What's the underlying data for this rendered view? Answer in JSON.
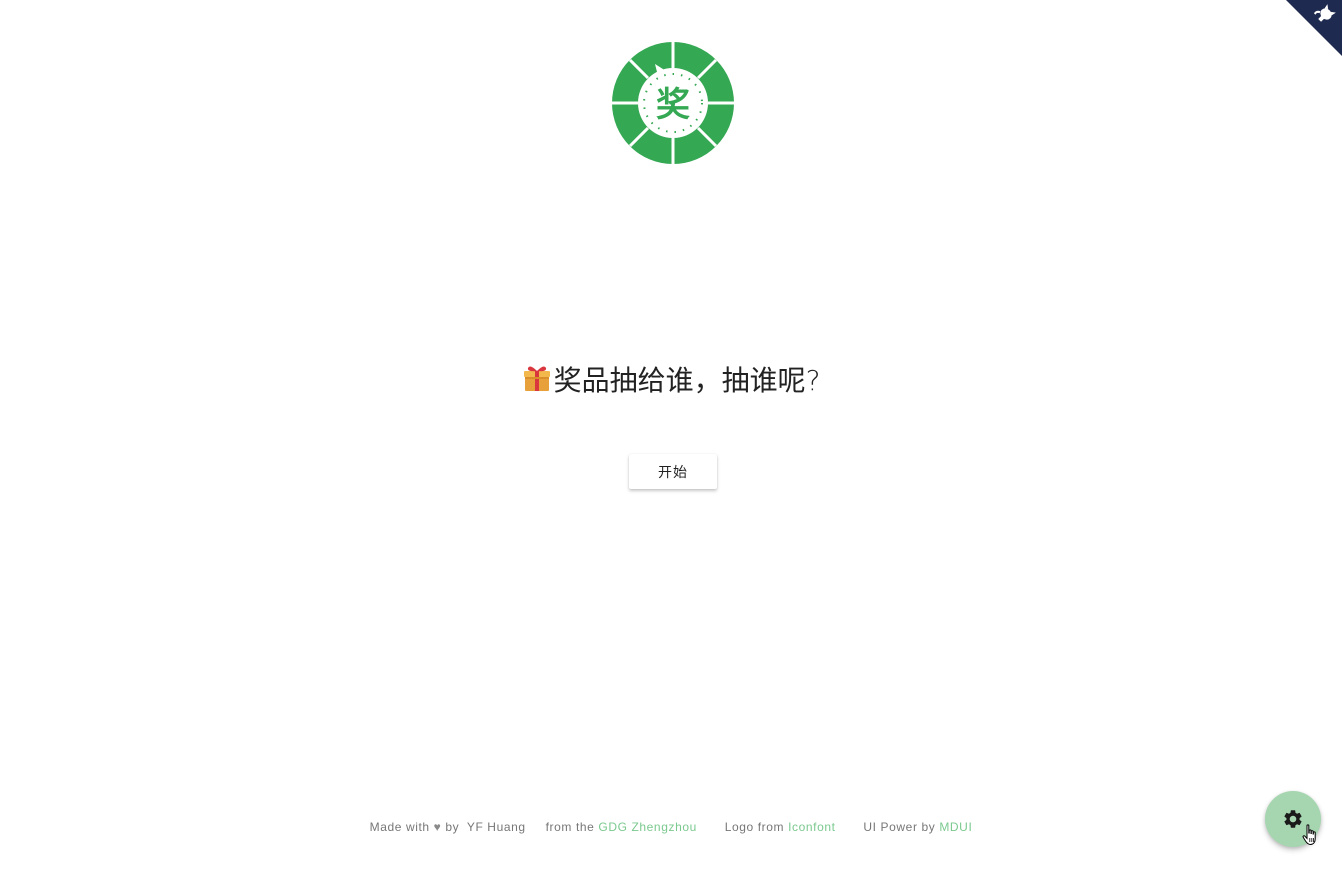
{
  "title": {
    "gift_icon": "gift-emoji",
    "text": "奖品抽给谁，抽谁呢?"
  },
  "logo": {
    "icon": "prize-wheel-logo",
    "char": "奖",
    "color": "#34a853"
  },
  "start_button": {
    "label": "开始"
  },
  "footer": {
    "made_with": "Made with",
    "by": "by",
    "author": "YF Huang",
    "from_the": "from the",
    "gdg_link": "GDG Zhengzhou",
    "logo_from": "Logo from",
    "iconfont_link": "Iconfont",
    "ui_power_by": "UI Power by",
    "mdui_link": "MDUI"
  },
  "fab": {
    "icon": "gear-icon",
    "color": "#a5d6b0"
  },
  "github_corner": {
    "icon": "github-octocat-icon",
    "color": "#1e2a4f"
  },
  "colors": {
    "accent": "#34a853",
    "link": "#7bc98f"
  }
}
